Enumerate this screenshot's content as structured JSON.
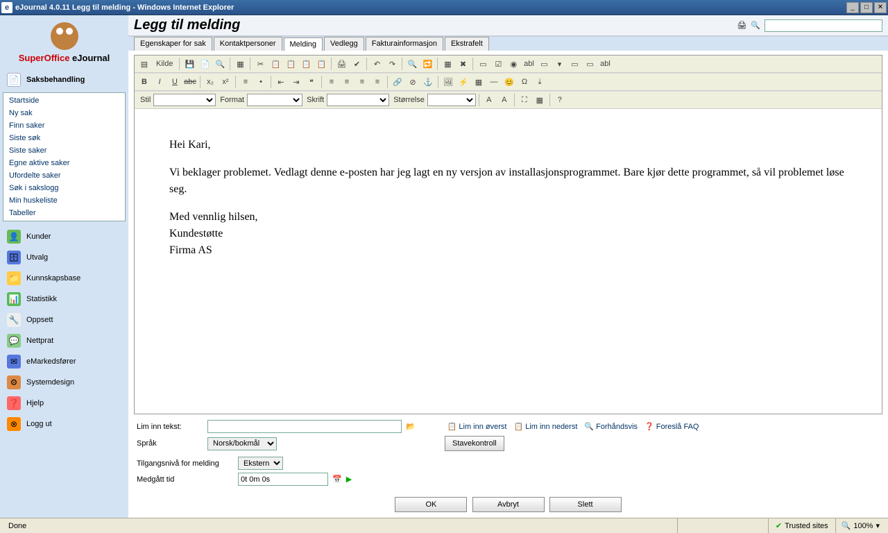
{
  "window": {
    "title": "eJournal 4.0.11 Legg til melding - Windows Internet Explorer"
  },
  "logo": {
    "red": "SuperOffice",
    "black": " eJournal"
  },
  "header": {
    "title": "Legg til melding",
    "search_placeholder": ""
  },
  "sidebar": {
    "saksbehandling": {
      "label": "Saksbehandling"
    },
    "submenu": [
      {
        "label": "Startside"
      },
      {
        "label": "Ny sak"
      },
      {
        "label": "Finn saker"
      },
      {
        "label": "Siste søk"
      },
      {
        "label": "Siste saker"
      },
      {
        "label": "Egne aktive saker"
      },
      {
        "label": "Ufordelte saker"
      },
      {
        "label": "Søk i sakslogg"
      },
      {
        "label": "Min huskeliste"
      },
      {
        "label": "Tabeller"
      }
    ],
    "items": [
      {
        "label": "Kunder",
        "icon": "👤",
        "bg": "#6b5"
      },
      {
        "label": "Utvalg",
        "icon": "🗄",
        "bg": "#57d"
      },
      {
        "label": "Kunnskapsbase",
        "icon": "📁",
        "bg": "#fc4"
      },
      {
        "label": "Statistikk",
        "icon": "📊",
        "bg": "#5b5"
      },
      {
        "label": "Oppsett",
        "icon": "🔧",
        "bg": "#bbb"
      },
      {
        "label": "Nettprat",
        "icon": "💬",
        "bg": "#8c8"
      },
      {
        "label": "eMarkedsfører",
        "icon": "✉",
        "bg": "#57d"
      },
      {
        "label": "Systemdesign",
        "icon": "⚙",
        "bg": "#d84"
      },
      {
        "label": "Hjelp",
        "icon": "❓",
        "bg": "#f66"
      },
      {
        "label": "Logg ut",
        "icon": "⊗",
        "bg": "#f80"
      }
    ]
  },
  "tabs": [
    {
      "label": "Egenskaper for sak"
    },
    {
      "label": "Kontaktpersoner"
    },
    {
      "label": "Melding",
      "active": true
    },
    {
      "label": "Vedlegg"
    },
    {
      "label": "Fakturainformasjon"
    },
    {
      "label": "Ekstrafelt"
    }
  ],
  "editor_toolbar": {
    "source_label": "Kilde",
    "style_label": "Stil",
    "format_label": "Format",
    "font_label": "Skrift",
    "size_label": "Størrelse"
  },
  "message": {
    "p1": "Hei Kari,",
    "p2": "Vi beklager problemet. Vedlagt denne e-posten har jeg lagt en ny versjon av installasjonsprogrammet. Bare kjør dette programmet, så vil problemet løse seg.",
    "p3": "Med vennlig hilsen,\nKundestøtte\nFirma AS"
  },
  "form": {
    "paste_label": "Lim inn tekst:",
    "paste_top": "Lim inn øverst",
    "paste_bottom": "Lim inn nederst",
    "preview": "Forhåndsvis",
    "suggest_faq": "Foreslå FAQ",
    "language_label": "Språk",
    "language_value": "Norsk/bokmål",
    "spellcheck": "Stavekontroll",
    "access_label": "Tilgangsnivå for melding",
    "access_value": "Ekstern",
    "time_label": "Medgått tid",
    "time_value": "0t 0m 0s"
  },
  "buttons": {
    "ok": "OK",
    "cancel": "Avbryt",
    "delete": "Slett"
  },
  "statusbar": {
    "done": "Done",
    "trusted": "Trusted sites",
    "zoom": "100%"
  }
}
